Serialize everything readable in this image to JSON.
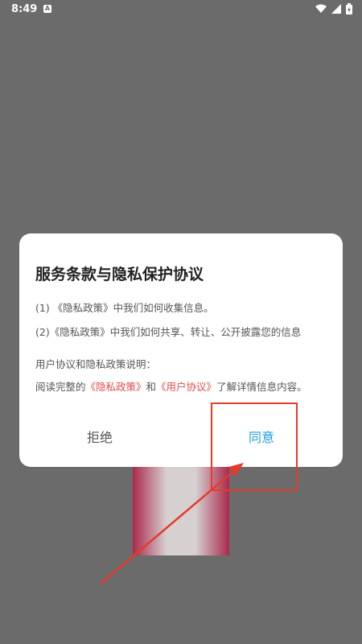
{
  "status": {
    "time": "8:49",
    "notification_letter": "A"
  },
  "dialog": {
    "title": "服务条款与隐私保护协议",
    "item1": "(1) 《隐私政策》中我们如何收集信息。",
    "item2": "(2)《隐私政策》中我们如何共享、转让、公开披露您的信息",
    "note_heading": "用户协议和隐私政策说明：",
    "note_prefix": "阅读完整的",
    "privacy_link": "《隐私政策》",
    "and_text": "和",
    "terms_link": "《用户协议》",
    "note_suffix": "了解详情信息内容。",
    "reject_label": "拒绝",
    "agree_label": "同意"
  },
  "colors": {
    "link": "#e64a4a",
    "agree": "#20a0e8",
    "annotation": "#e53a2c"
  }
}
